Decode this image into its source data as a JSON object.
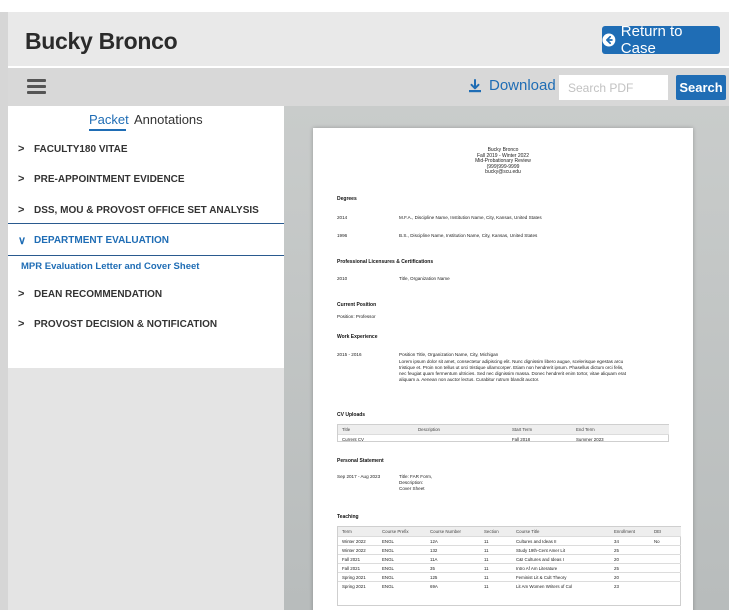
{
  "header": {
    "title": "Bucky Bronco",
    "return_label": "Return to Case"
  },
  "toolbar": {
    "download_label": "Download",
    "search_placeholder": "Search PDF",
    "search_label": "Search"
  },
  "sidebar": {
    "tabs": [
      "Packet",
      "Annotations"
    ],
    "sections": [
      {
        "label": "FACULTY180 VITAE",
        "chevron": ">"
      },
      {
        "label": "PRE-APPOINTMENT EVIDENCE",
        "chevron": ">"
      },
      {
        "label": "DSS, MOU & PROVOST OFFICE SET ANALYSIS",
        "chevron": ">"
      },
      {
        "label": "DEPARTMENT EVALUATION",
        "chevron": "∨"
      },
      {
        "label": "DEAN RECOMMENDATION",
        "chevron": ">"
      },
      {
        "label": "PROVOST DECISION & NOTIFICATION",
        "chevron": ">"
      }
    ],
    "sub_item": "MPR Evaluation Letter and Cover Sheet"
  },
  "pdf": {
    "name": "Bucky Bronco",
    "term": "Fall 2019 - Winter 2022",
    "review": "Mid-Probationary Review",
    "phone": "(999)999-9999",
    "email": "bucky@scu.edu",
    "degrees_heading": "Degrees",
    "degrees": [
      {
        "year": "2014",
        "text": "M.F.A., Discipline Name, Institution Name, City, Kansas, United States"
      },
      {
        "year": "1996",
        "text": "B.S., Discipline Name, Institution Name, City, Kansas, United States"
      }
    ],
    "licensures_heading": "Professional Licensures & Certifications",
    "licensure": {
      "year": "2010",
      "text": "Title, Organization Name"
    },
    "current_position_heading": "Current Position",
    "current_position": "Position: Professor",
    "work_heading": "Work Experience",
    "work": {
      "years": "2015 - 2016",
      "title": "Position Title, Organization Name, City, Michigan",
      "lines": [
        "Lorem ipsum dolor sit amet, consectetur adipiscing elit. Nunc dignissim libero augue, scelerisque egestas arcu",
        "tristique et. Proin non tellus ut orci tristique ullamcorper. Etiam non hendrerit ipsum. Phasellus dictum orci felis,",
        "nec feugiat quam fermentum ultricies. Sed nec dignissim massa. Donec hendrerit enim tortor, vitae aliquam erat",
        "aliquam a. Aenean non auctor lectus. Curabitur rutrum blandit auctor."
      ]
    },
    "cv_heading": "CV Uploads",
    "cv_columns": [
      "Title",
      "Description",
      "Start Term",
      "End Term"
    ],
    "cv_row": [
      "Current CV",
      "",
      "Fall 2018",
      "Summer 2023"
    ],
    "statement_heading": "Personal Statement",
    "statement": {
      "dates": "Sep 2017 - Aug 2023",
      "lines": [
        "Title: FAR Form,",
        "Description:",
        "Cover Sheet"
      ]
    },
    "teaching_heading": "Teaching",
    "teaching_columns": [
      "Term",
      "Course Prefix",
      "Course Number",
      "Section",
      "Course Title",
      "Enrollment",
      "DEI"
    ],
    "teaching_rows": [
      [
        "Winter 2022",
        "ENGL",
        "12A",
        "11",
        "Cultures and Ideas II",
        "34",
        "No"
      ],
      [
        "Winter 2022",
        "ENGL",
        "132",
        "11",
        "Study 19th-Cent Amer Lit",
        "25",
        ""
      ],
      [
        "Fall 2021",
        "ENGL",
        "11A",
        "11",
        "C&I Cultures and Ideas I",
        "20",
        ""
      ],
      [
        "Fall 2021",
        "ENGL",
        "35",
        "11",
        "Intro Af Am Literature",
        "25",
        ""
      ],
      [
        "Spring 2021",
        "ENGL",
        "125",
        "11",
        "Feminist Lit & Cult Theory",
        "20",
        ""
      ],
      [
        "Spring 2021",
        "ENGL",
        "69A",
        "11",
        "Lit Am Women Writers of Col",
        "23",
        ""
      ]
    ]
  }
}
